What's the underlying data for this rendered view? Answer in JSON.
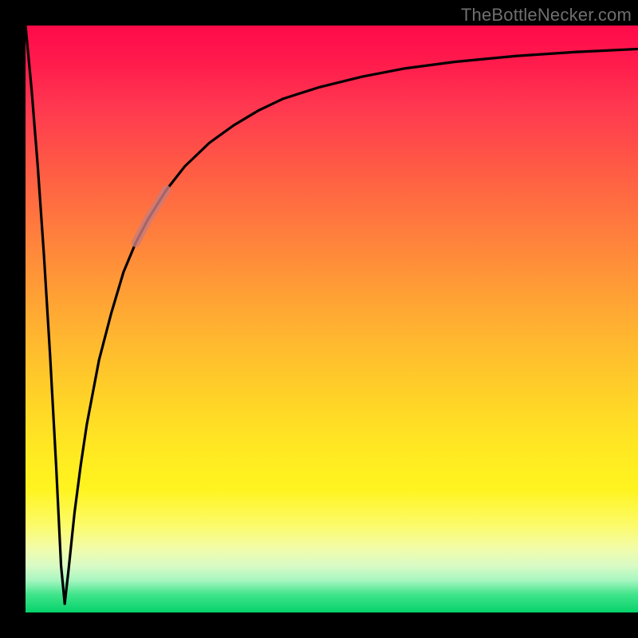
{
  "watermark": {
    "text": "TheBottleNecker.com"
  },
  "colors": {
    "frame": "#000000",
    "curve": "#000000",
    "highlight": "#c97b7b",
    "gradient_top": "#ff0a4a",
    "gradient_bottom": "#05d26a"
  },
  "chart_data": {
    "type": "line",
    "title": "",
    "xlabel": "",
    "ylabel": "",
    "xlim": [
      0,
      100
    ],
    "ylim": [
      0,
      100
    ],
    "grid": false,
    "series": [
      {
        "name": "bottleneck-curve-left",
        "x": [
          0,
          1,
          2,
          3,
          4,
          5,
          5.8,
          6.4
        ],
        "values": [
          100,
          89,
          76,
          61,
          44,
          25,
          8,
          1.5
        ]
      },
      {
        "name": "bottleneck-curve-right",
        "x": [
          6.4,
          7,
          8,
          9,
          10,
          12,
          14,
          16,
          18,
          20,
          23,
          26,
          30,
          34,
          38,
          42,
          48,
          55,
          62,
          70,
          80,
          90,
          100
        ],
        "values": [
          1.5,
          7,
          17,
          25,
          32,
          43,
          51,
          58,
          63,
          67,
          72,
          76,
          80,
          83,
          85.5,
          87.5,
          89.5,
          91.3,
          92.7,
          93.8,
          94.8,
          95.5,
          96
        ]
      }
    ],
    "annotations": [
      {
        "name": "highlight-segment",
        "approx_x_range": [
          18,
          25
        ],
        "approx_y_range": [
          63,
          75
        ],
        "color": "#c97b7b"
      }
    ]
  }
}
